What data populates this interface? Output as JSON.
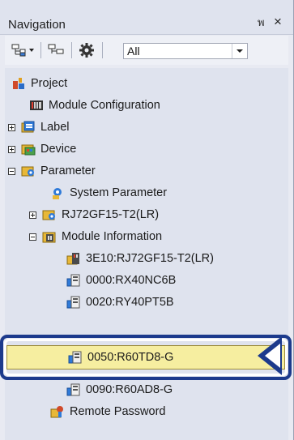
{
  "window": {
    "title": "Navigation",
    "pin_glyph": "พ",
    "close_glyph": "×"
  },
  "toolbar": {
    "filter_value": "All",
    "icons": [
      "tree-view-icon",
      "collapse-all-icon",
      "settings-gear-icon",
      "dropdown-arrow-icon"
    ]
  },
  "tree": {
    "project": {
      "label": "Project",
      "icon": "project-icon"
    },
    "module_configuration": {
      "label": "Module Configuration",
      "icon": "module-config-icon"
    },
    "label": {
      "label": "Label",
      "icon": "label-icon",
      "expander": "plus"
    },
    "device": {
      "label": "Device",
      "icon": "device-icon",
      "expander": "plus"
    },
    "parameter": {
      "label": "Parameter",
      "icon": "parameter-icon",
      "expander": "minus"
    },
    "system_parameter": {
      "label": "System Parameter",
      "icon": "system-parameter-icon"
    },
    "cpu_module": {
      "label": "RJ72GF15-T2(LR)",
      "icon": "cpu-module-icon",
      "expander": "plus"
    },
    "module_information": {
      "label": "Module Information",
      "icon": "module-info-folder-icon",
      "expander": "minus"
    },
    "modules": [
      {
        "label": "3E10:RJ72GF15-T2(LR)",
        "icon": "network-module-icon"
      },
      {
        "label": "0000:RX40NC6B",
        "icon": "io-module-icon"
      },
      {
        "label": "0020:RY40PT5B",
        "icon": "io-module-icon"
      },
      {
        "label": "0050:R60TD8-G",
        "icon": "io-module-icon",
        "selected": true
      },
      {
        "label": "0090:R60AD8-G",
        "icon": "io-module-icon"
      }
    ],
    "remote_password": {
      "label": "Remote Password",
      "icon": "remote-password-icon"
    }
  },
  "colors": {
    "selection_bg": "#f6eea0",
    "callout": "#1c3a8c"
  }
}
